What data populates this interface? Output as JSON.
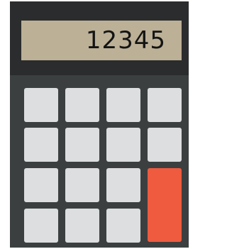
{
  "calculator": {
    "display": {
      "value": "12345"
    },
    "colors": {
      "body_top": "#2a2c2d",
      "body_keypad": "#3b3f40",
      "display_bg": "#bcb096",
      "key": "#dcdedf",
      "equals_key": "#ee5b3f"
    },
    "keys": {
      "row_count": 4,
      "column_count": 4,
      "blank_key_count": 15,
      "accent_key": "tall-accent-key"
    }
  }
}
